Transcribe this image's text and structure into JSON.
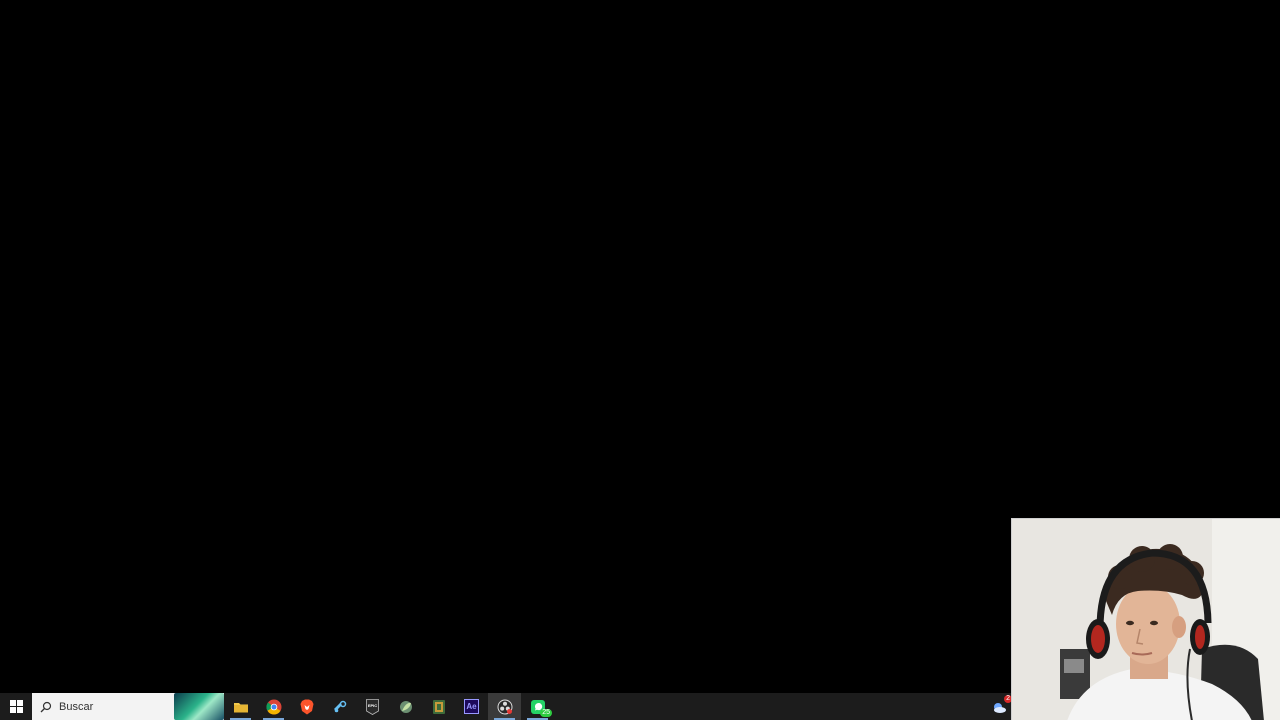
{
  "taskbar": {
    "search": {
      "placeholder": "Buscar",
      "highlight": "aurora-search-highlight"
    },
    "apps": [
      {
        "name": "file-explorer",
        "icon": "folder-icon",
        "color": "#f2c94c"
      },
      {
        "name": "chrome",
        "icon": "chrome-icon",
        "color": "#4285f4"
      },
      {
        "name": "brave",
        "icon": "brave-icon",
        "color": "#fb542b"
      },
      {
        "name": "steam",
        "icon": "steam-icon",
        "color": "#66c0f4"
      },
      {
        "name": "epic-games",
        "icon": "epic-games-icon",
        "label": "EPIC",
        "color": "#ffffff"
      },
      {
        "name": "app-leaf",
        "icon": "leaf-icon",
        "color": "#9ccc65"
      },
      {
        "name": "app-book",
        "icon": "book-icon",
        "color": "#c79b3b"
      },
      {
        "name": "after-effects",
        "icon": "after-effects-icon",
        "label": "Ae",
        "color": "#9999ff"
      },
      {
        "name": "obs",
        "icon": "obs-icon",
        "color": "#ffffff",
        "active": true
      },
      {
        "name": "whatsapp",
        "icon": "whatsapp-icon",
        "badge": "25",
        "color": "#25d366"
      }
    ],
    "tray": {
      "weather_icon": "weather-cloud-icon",
      "weather_badge": "2"
    }
  },
  "webcam": {
    "icon": "person-webcam-feed"
  }
}
